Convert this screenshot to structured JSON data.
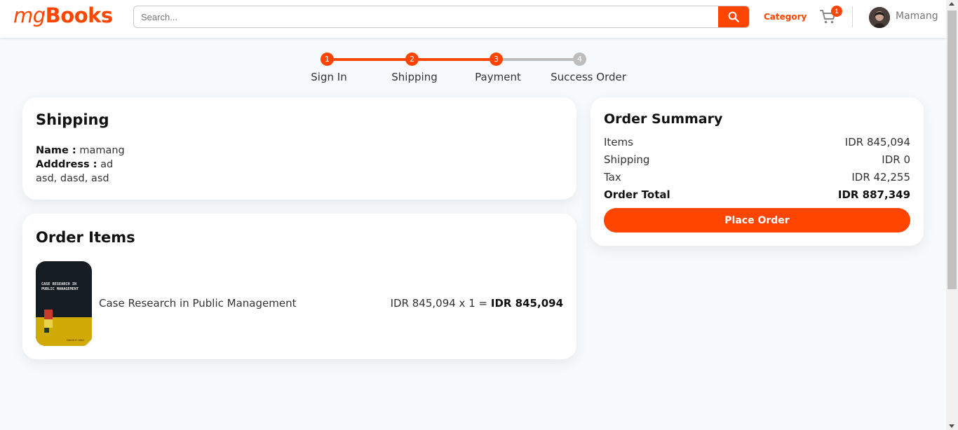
{
  "header": {
    "logo_prefix": "mg",
    "logo_main": "Books",
    "search_placeholder": "Search...",
    "category_label": "Category",
    "cart_count": "1",
    "username": "Mamang"
  },
  "stepper": {
    "steps": [
      {
        "number": "1",
        "label": "Sign In",
        "active": true
      },
      {
        "number": "2",
        "label": "Shipping",
        "active": true
      },
      {
        "number": "3",
        "label": "Payment",
        "active": true
      },
      {
        "number": "4",
        "label": "Success Order",
        "active": false
      }
    ]
  },
  "shipping": {
    "title": "Shipping",
    "name_label": "Name :",
    "name_value": "mamang",
    "address_label": "Adddress :",
    "address_line1": "ad",
    "address_line2": "asd, dasd, asd"
  },
  "order_items": {
    "title": "Order Items",
    "items": [
      {
        "name": "Case Research in Public Management",
        "price_calc": "IDR 845,094 x 1 =",
        "total": "IDR 845,094",
        "cover_title": "CASE RESEARCH IN PUBLIC MANAGEMENT"
      }
    ]
  },
  "summary": {
    "title": "Order Summary",
    "rows": [
      {
        "label": "Items",
        "value": "IDR 845,094"
      },
      {
        "label": "Shipping",
        "value": "IDR 0"
      },
      {
        "label": "Tax",
        "value": "IDR 42,255"
      },
      {
        "label": "Order Total",
        "value": "IDR 887,349"
      }
    ],
    "button_label": "Place Order"
  },
  "colors": {
    "accent": "#ff4500",
    "inactive": "#bdbdbd",
    "background": "#f7fafc"
  },
  "icons": [
    "search-icon",
    "cart-icon",
    "avatar"
  ]
}
